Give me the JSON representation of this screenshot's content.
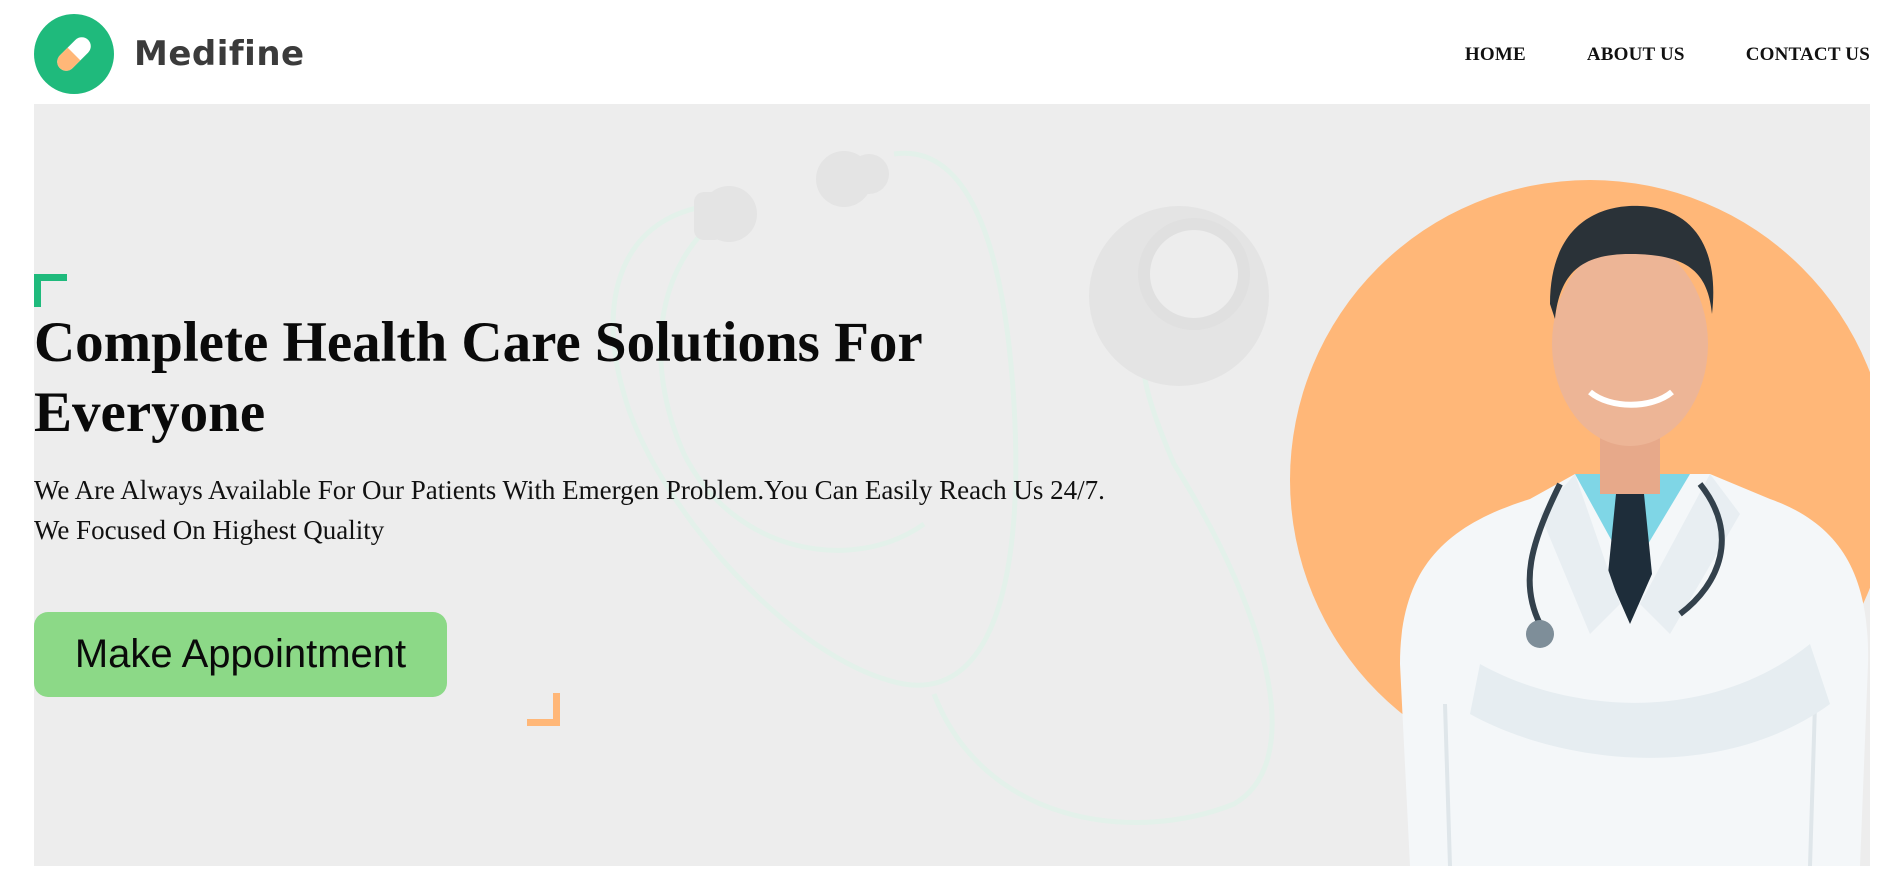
{
  "brand": {
    "name": "Medifine",
    "logo_icon": "pill-icon",
    "accent_color": "#1fba7c"
  },
  "nav": {
    "items": [
      {
        "label": "HOME"
      },
      {
        "label": "ABOUT US"
      },
      {
        "label": "CONTACT US"
      }
    ]
  },
  "hero": {
    "title": "Complete Health Care Solutions For Everyone",
    "subtitle": "We Are Always Available For Our Patients With Emergen Problem.You Can Easily Reach Us 24/7. We Focused On Highest Quality",
    "cta_label": "Make Appointment",
    "cta_color": "#8cd987",
    "circle_color": "#ffb778",
    "background_color": "#ededed",
    "image": "doctor-photo"
  }
}
